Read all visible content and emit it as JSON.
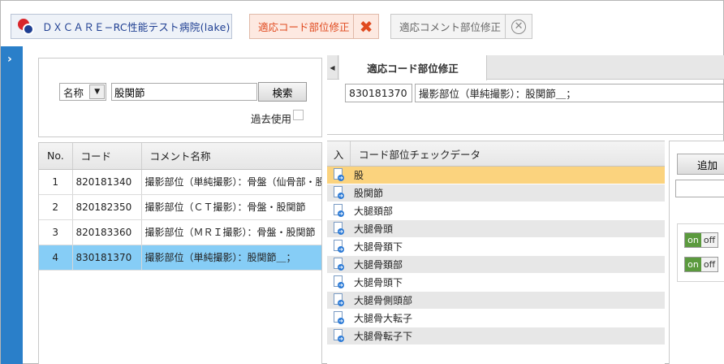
{
  "header": {
    "tabs": [
      {
        "label": "ＤＸＣＡＲＥ−RC性能テスト病院(lake)"
      },
      {
        "label": "適応コード部位修正",
        "close": "✖"
      },
      {
        "label": "適応コメント部位修正",
        "close": "✕"
      }
    ]
  },
  "sidebar": {
    "toggle": "›"
  },
  "search": {
    "field_select": "名称",
    "query": "股関節",
    "button": "検索",
    "past_use_label": "過去使用"
  },
  "results": {
    "columns": [
      "No.",
      "コード",
      "コメント名称"
    ],
    "rows": [
      {
        "no": "1",
        "code": "820181340",
        "name": "撮影部位（単純撮影）：骨盤（仙骨部・股関"
      },
      {
        "no": "2",
        "code": "820182350",
        "name": "撮影部位（ＣＴ撮影）：骨盤・股関節"
      },
      {
        "no": "3",
        "code": "820183360",
        "name": "撮影部位（ＭＲＩ撮影）：骨盤・股関節"
      },
      {
        "no": "4",
        "code": "830181370",
        "name": "撮影部位（単純撮影）：股関節＿；"
      }
    ],
    "selected_index": 3
  },
  "detail": {
    "tab_label": "適応コード部位修正",
    "code": "830181370",
    "name": "撮影部位（単純撮影）：股関節＿；"
  },
  "check_data": {
    "col_in": "入",
    "col_title": "コード部位チェックデータ",
    "items": [
      "股",
      "股関節",
      "大腿頚部",
      "大腿骨頭",
      "大腿骨頚下",
      "大腿骨頚部",
      "大腿骨頭下",
      "大腿骨側頭部",
      "大腿骨大転子",
      "大腿骨転子下"
    ],
    "selected_index": 0
  },
  "side": {
    "add_button": "追加",
    "toggles": [
      {
        "on": "on",
        "off": "off"
      },
      {
        "on": "on",
        "off": "off"
      }
    ]
  }
}
